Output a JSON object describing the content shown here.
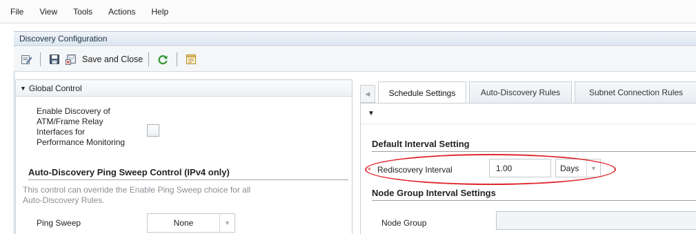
{
  "menu": [
    "File",
    "View",
    "Tools",
    "Actions",
    "Help"
  ],
  "window": {
    "title": "Discovery Configuration"
  },
  "toolbar": {
    "save_close_label": "Save and Close"
  },
  "left_panel": {
    "header": "Global Control",
    "atm_label_lines": [
      "Enable Discovery of",
      "ATM/Frame Relay",
      "Interfaces for",
      "Performance Monitoring"
    ],
    "atm_checked": false,
    "ping_section_title": "Auto-Discovery Ping Sweep Control (IPv4 only)",
    "ping_help_lines": [
      "This control can override the Enable Ping Sweep choice for all",
      "Auto-Discovery Rules."
    ],
    "ping_label": "Ping Sweep",
    "ping_value": "None"
  },
  "tabs": [
    {
      "label": "Schedule Settings",
      "active": true
    },
    {
      "label": "Auto-Discovery Rules",
      "active": false
    },
    {
      "label": "Subnet Connection Rules",
      "active": false
    }
  ],
  "right_panel": {
    "default_section_title": "Default Interval Setting",
    "required_marker": "*",
    "rediscovery_label": "Rediscovery Interval",
    "rediscovery_value": "1.00",
    "rediscovery_unit": "Days",
    "node_group_section_title": "Node Group Interval Settings",
    "node_group_label": "Node Group",
    "node_group_value": ""
  },
  "colors": {
    "highlight": "#e0272f",
    "required": "#d0342c"
  },
  "icons": [
    "edit-icon",
    "save-icon",
    "save-and-close-icon",
    "refresh-icon",
    "export-icon"
  ]
}
